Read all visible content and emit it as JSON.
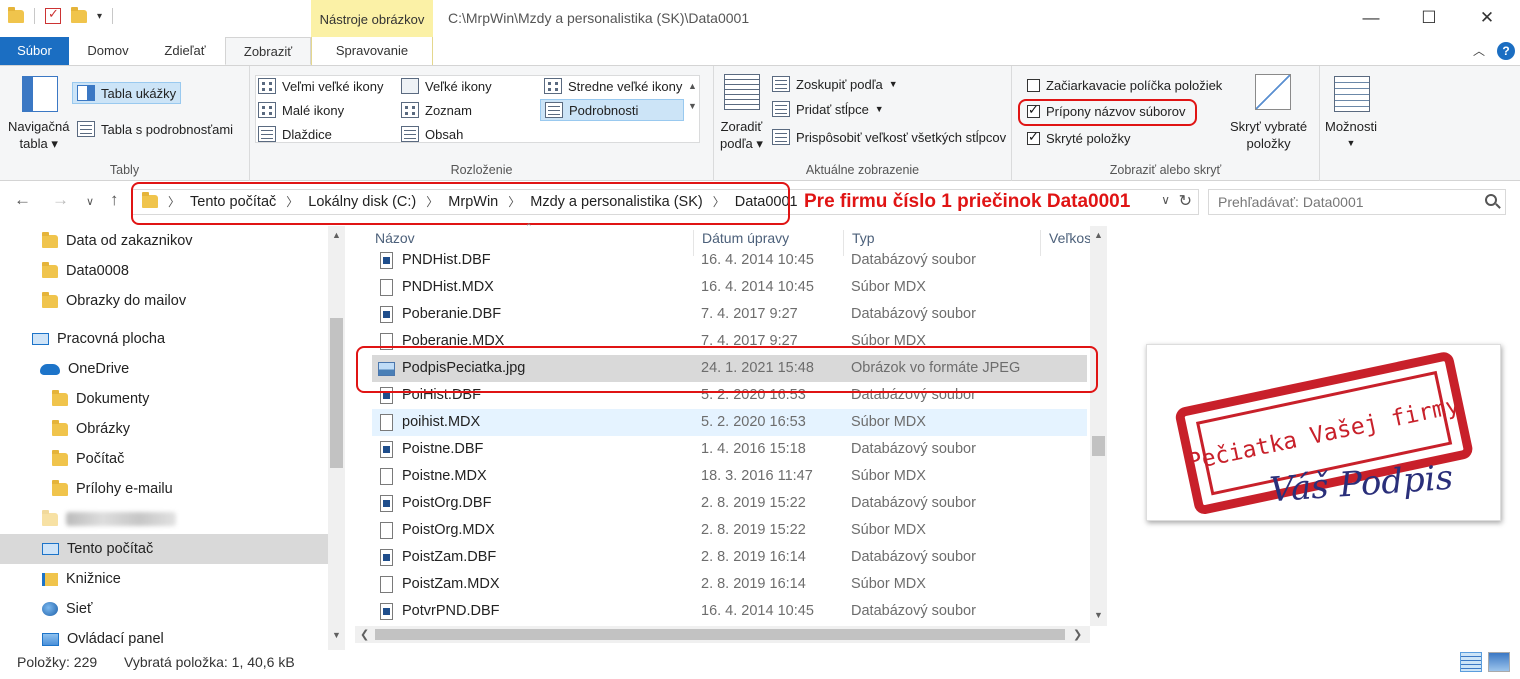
{
  "titlebar": {
    "contextual_tab": "Nástroje obrázkov",
    "path": "C:\\MrpWin\\Mzdy a personalistika (SK)\\Data0001",
    "minimize": "—",
    "maximize": "☐",
    "close": "✕"
  },
  "tabs": {
    "file": "Súbor",
    "home": "Domov",
    "share": "Zdieľať",
    "view": "Zobraziť",
    "manage": "Spravovanie"
  },
  "ribbon": {
    "panes": {
      "label": "Tably",
      "nav_pane": [
        "Navigačná",
        "tabla"
      ],
      "preview_pane": "Tabla ukážky",
      "details_pane": "Tabla s podrobnosťami"
    },
    "layout": {
      "label": "Rozloženie",
      "extra_large": "Veľmi veľké ikony",
      "large": "Veľké ikony",
      "medium": "Stredne veľké ikony",
      "small": "Malé ikony",
      "list": "Zoznam",
      "details": "Podrobnosti",
      "tiles": "Dlaždice",
      "content": "Obsah"
    },
    "current_view": {
      "label": "Aktuálne zobrazenie",
      "sort_by": [
        "Zoradiť",
        "podľa"
      ],
      "group_by": "Zoskupiť podľa",
      "add_columns": "Pridať stĺpce",
      "fit_columns": "Prispôsobiť veľkosť všetkých stĺpcov"
    },
    "show_hide": {
      "label": "Zobraziť alebo skryť",
      "item_checkboxes": "Začiarkavacie políčka položiek",
      "item_checkboxes_checked": false,
      "file_extensions": "Prípony názvov súborov",
      "file_extensions_checked": true,
      "hidden_items": "Skryté položky",
      "hidden_items_checked": true,
      "hide_selected": [
        "Skryť vybraté",
        "položky"
      ]
    },
    "options": "Možnosti"
  },
  "address": {
    "crumbs": [
      "Tento počítač",
      "Lokálny disk (C:)",
      "MrpWin",
      "Mzdy a personalistika (SK)",
      "Data0001"
    ],
    "annotation": "Pre firmu číslo 1 priečinok Data0001",
    "search_placeholder": "Prehľadávať: Data0001"
  },
  "nav_pane": {
    "items": [
      {
        "label": "Data od zakaznikov",
        "icon": "folder-icon"
      },
      {
        "label": "Data0008",
        "icon": "folder-icon"
      },
      {
        "label": "Obrazky do mailov",
        "icon": "folder-icon"
      },
      {
        "label": "Pracovná plocha",
        "icon": "desktop-icon"
      },
      {
        "label": "OneDrive",
        "icon": "onedrive-icon"
      },
      {
        "label": "Dokumenty",
        "icon": "folder-icon"
      },
      {
        "label": "Obrázky",
        "icon": "folder-icon"
      },
      {
        "label": "Počítač",
        "icon": "folder-icon"
      },
      {
        "label": "Prílohy e-mailu",
        "icon": "folder-icon"
      },
      {
        "label": "Tento počítač",
        "icon": "pc-icon"
      },
      {
        "label": "Knižnice",
        "icon": "library-icon"
      },
      {
        "label": "Sieť",
        "icon": "network-icon"
      },
      {
        "label": "Ovládací panel",
        "icon": "control-panel-icon"
      }
    ]
  },
  "file_list": {
    "columns": {
      "name": "Názov",
      "date": "Dátum úpravy",
      "type": "Typ",
      "size": "Veľkos"
    },
    "rows": [
      {
        "name": "PNDHist.DBF",
        "date": "16. 4. 2014 10:45",
        "type": "Databázový soubor"
      },
      {
        "name": "PNDHist.MDX",
        "date": "16. 4. 2014 10:45",
        "type": "Súbor MDX"
      },
      {
        "name": "Poberanie.DBF",
        "date": "7. 4. 2017 9:27",
        "type": "Databázový soubor"
      },
      {
        "name": "Poberanie.MDX",
        "date": "7. 4. 2017 9:27",
        "type": "Súbor MDX"
      },
      {
        "name": "PodpisPeciatka.jpg",
        "date": "24. 1. 2021 15:48",
        "type": "Obrázok vo formáte JPEG"
      },
      {
        "name": "PoiHist.DBF",
        "date": "5. 2. 2020 16:53",
        "type": "Databázový soubor"
      },
      {
        "name": "poihist.MDX",
        "date": "5. 2. 2020 16:53",
        "type": "Súbor MDX"
      },
      {
        "name": "Poistne.DBF",
        "date": "1. 4. 2016 15:18",
        "type": "Databázový soubor"
      },
      {
        "name": "Poistne.MDX",
        "date": "18. 3. 2016 11:47",
        "type": "Súbor MDX"
      },
      {
        "name": "PoistOrg.DBF",
        "date": "2. 8. 2019 15:22",
        "type": "Databázový soubor"
      },
      {
        "name": "PoistOrg.MDX",
        "date": "2. 8. 2019 15:22",
        "type": "Súbor MDX"
      },
      {
        "name": "PoistZam.DBF",
        "date": "2. 8. 2019 16:14",
        "type": "Databázový soubor"
      },
      {
        "name": "PoistZam.MDX",
        "date": "2. 8. 2019 16:14",
        "type": "Súbor MDX"
      },
      {
        "name": "PotvrPND.DBF",
        "date": "16. 4. 2014 10:45",
        "type": "Databázový soubor"
      }
    ]
  },
  "preview": {
    "stamp_text": "Pečiatka Vašej firmy",
    "signature_text": "Váš Podpis",
    "stamp_color": "#c8202a",
    "signature_color": "#2a2f7a"
  },
  "status": {
    "count": "Položky: 229",
    "selection": "Vybratá položka: 1, 40,6 kB"
  },
  "colors": {
    "accent": "#1b6ec2",
    "annotation": "#e01414",
    "context_tab": "#fbf1a6"
  }
}
